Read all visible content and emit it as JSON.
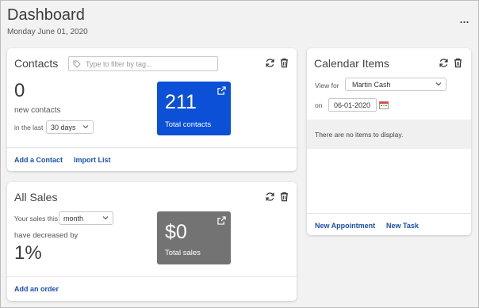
{
  "header": {
    "title": "Dashboard",
    "date": "Monday June 01, 2020",
    "more_label": "..."
  },
  "contacts": {
    "title": "Contacts",
    "filter_placeholder": "Type to filter by tag...",
    "new_count": "0",
    "new_label": "new contacts",
    "period_label": "in the last",
    "period_value": "30 days",
    "total_value": "211",
    "total_label": "Total contacts",
    "add_link": "Add a Contact",
    "import_link": "Import List"
  },
  "sales": {
    "title": "All Sales",
    "prefix_label": "Your sales this",
    "period_value": "month",
    "trend_label": "have decreased by",
    "percent": "1%",
    "total_value": "$0",
    "total_label": "Total sales",
    "add_link": "Add an order"
  },
  "calendar": {
    "title": "Calendar Items",
    "view_for_label": "View for",
    "view_for_value": "Martin Cash",
    "on_label": "on",
    "date_value": "06-01-2020",
    "empty_message": "There are no items to display.",
    "new_appointment_link": "New Appointment",
    "new_task_link": "New Task"
  },
  "colors": {
    "contacts_tile": "#0b50d6",
    "sales_tile": "#737373",
    "link": "#1a4fb0"
  },
  "icons": [
    "refresh-icon",
    "trash-icon",
    "tag-icon",
    "external-link-icon",
    "chevron-down-icon",
    "calendar-icon"
  ]
}
